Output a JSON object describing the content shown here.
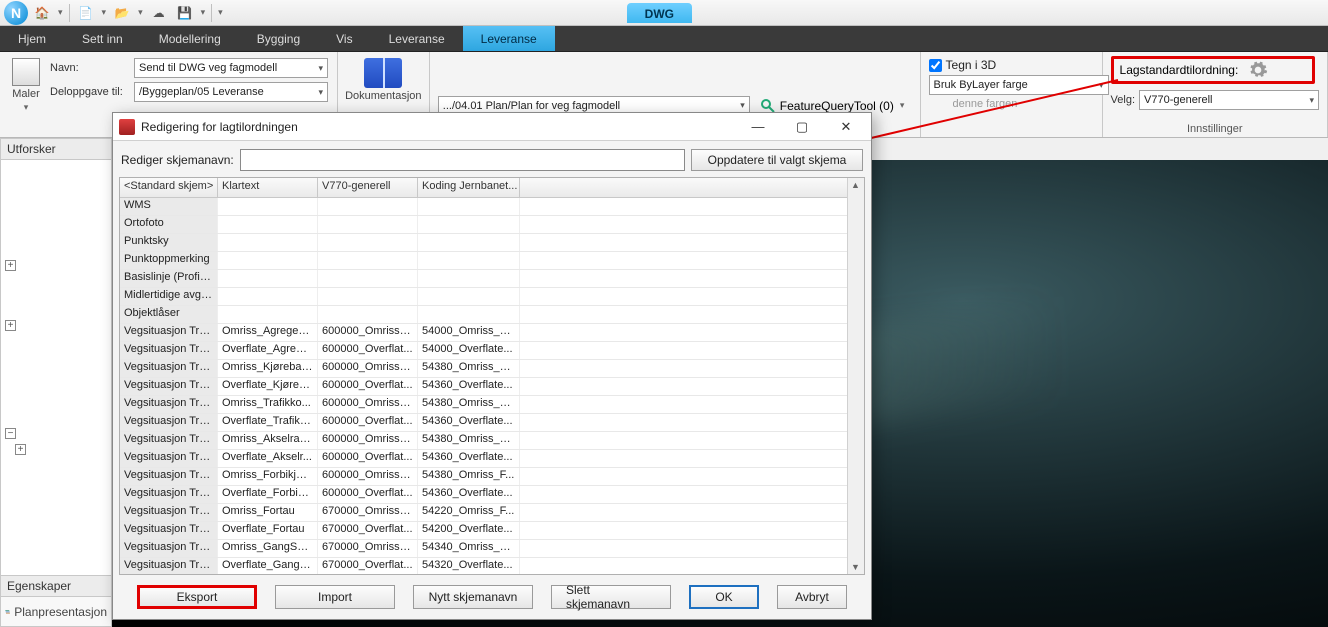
{
  "qat": {
    "logo_letter": "N"
  },
  "dwg_tab": "DWG",
  "tabs": [
    "Hjem",
    "Sett inn",
    "Modellering",
    "Bygging",
    "Vis",
    "Leveranse",
    "Leveranse"
  ],
  "active_tab_index": 6,
  "ribbon": {
    "maler": {
      "big_label": "Maler",
      "navn_label": "Navn:",
      "navn_value": "Send til DWG veg fagmodell",
      "deloppgave_label": "Deloppgave til:",
      "deloppgave_value": "/Byggeplan/05 Leveranse",
      "dok_label": "Dokumentasjon"
    },
    "mid": {
      "plan_value": ".../04.01 Plan/Plan for veg fagmodell",
      "fq_label": "FeatureQueryTool (0)"
    },
    "right": {
      "chk_label": "Tegn i 3D",
      "bylayer_value": "Bruk ByLayer farge",
      "faded": "denne fargen"
    },
    "settings": {
      "lag_label": "Lagstandardtilordning:",
      "velg_label": "Velg:",
      "velg_value": "V770-generell",
      "group_label": "Innstillinger"
    }
  },
  "explorer": {
    "title": "Utforsker"
  },
  "props": {
    "title": "Egenskaper",
    "item": "Planpresentasjon"
  },
  "dialog": {
    "title": "Redigering for lagtilordningen",
    "edit_label": "Rediger skjemanavn:",
    "update_btn": "Oppdatere til valgt skjema",
    "columns": [
      "<Standard skjem>",
      "Klartext",
      "V770-generell",
      "Koding Jernbanet..."
    ],
    "rows": [
      [
        "WMS",
        "",
        "",
        ""
      ],
      [
        "Ortofoto",
        "",
        "",
        ""
      ],
      [
        "Punktsky",
        "",
        "",
        ""
      ],
      [
        "Punktoppmerking",
        "",
        "",
        ""
      ],
      [
        "Basislinje (Profiler)",
        "",
        "",
        ""
      ],
      [
        "Midlertidige avgre...",
        "",
        "",
        ""
      ],
      [
        "Objektlåser",
        "",
        "",
        ""
      ],
      [
        "Vegsituasjon Traf...",
        "Omriss_Agregerte...",
        "600000_Omriss_...",
        "54000_Omriss_A..."
      ],
      [
        "Vegsituasjon Traf...",
        "Overflate_Agrege...",
        "600000_Overflat...",
        "54000_Overflate..."
      ],
      [
        "Vegsituasjon Traf...",
        "Omriss_Kjørebane",
        "600000_Omriss_...",
        "54380_Omriss_Kj..."
      ],
      [
        "Vegsituasjon Traf...",
        "Overflate_Kjøreb...",
        "600000_Overflat...",
        "54360_Overflate..."
      ],
      [
        "Vegsituasjon Traf...",
        "Omriss_Trafikko...",
        "600000_Omriss_...",
        "54380_Omriss_Tr..."
      ],
      [
        "Vegsituasjon Traf...",
        "Overflate_Trafikk...",
        "600000_Overflat...",
        "54360_Overflate..."
      ],
      [
        "Vegsituasjon Traf...",
        "Omriss_Akselrasj...",
        "600000_Omriss_...",
        "54380_Omriss_A..."
      ],
      [
        "Vegsituasjon Traf...",
        "Overflate_Akselr...",
        "600000_Overflat...",
        "54360_Overflate..."
      ],
      [
        "Vegsituasjon Traf...",
        "Omriss_Forbikjøri...",
        "600000_Omriss_...",
        "54380_Omriss_F..."
      ],
      [
        "Vegsituasjon Traf...",
        "Overflate_Forbikj...",
        "600000_Overflat...",
        "54360_Overflate..."
      ],
      [
        "Vegsituasjon Traf...",
        "Omriss_Fortau",
        "670000_Omriss_...",
        "54220_Omriss_F..."
      ],
      [
        "Vegsituasjon Traf...",
        "Overflate_Fortau",
        "670000_Overflat...",
        "54200_Overflate..."
      ],
      [
        "Vegsituasjon Traf...",
        "Omriss_GangSyk...",
        "670000_Omriss_...",
        "54340_Omriss_G..."
      ],
      [
        "Vegsituasjon Traf...",
        "Overflate_GangS...",
        "670000_Overflat...",
        "54320_Overflate..."
      ]
    ],
    "buttons": {
      "eksport": "Eksport",
      "import": "Import",
      "nytt": "Nytt skjemanavn",
      "slett": "Slett skjemanavn",
      "ok": "OK",
      "avbryt": "Avbryt"
    }
  }
}
